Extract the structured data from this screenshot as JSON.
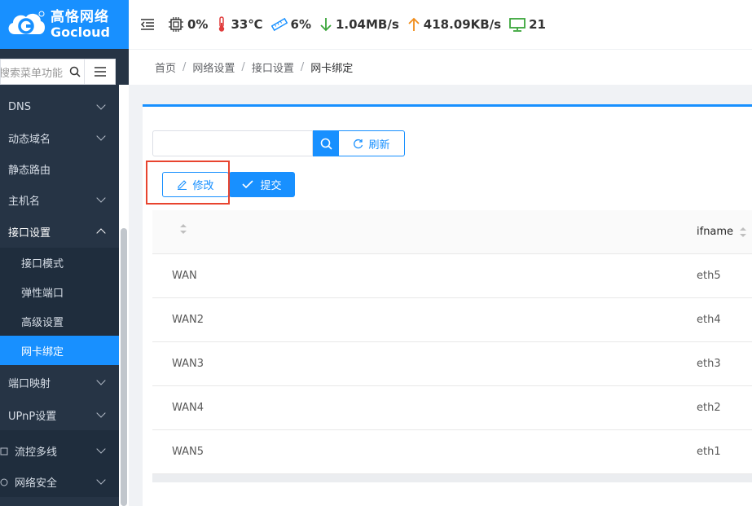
{
  "brand": {
    "name_cn": "高恪网络",
    "name_en": "Gocloud"
  },
  "header": {
    "cpu": "0%",
    "temperature": "33℃",
    "memory": "6%",
    "download": "1.04MB/s",
    "upload": "418.09KB/s",
    "devices": "21"
  },
  "sidebar": {
    "search_placeholder": "搜索菜单功能",
    "items": [
      {
        "label": "DNS",
        "expand": true
      },
      {
        "label": "动态域名",
        "expand": true
      },
      {
        "label": "静态路由",
        "expand": false
      },
      {
        "label": "主机名",
        "expand": true
      },
      {
        "label": "接口设置",
        "expand": true,
        "open": true,
        "children": [
          "接口模式",
          "弹性端口",
          "高级设置",
          "网卡绑定"
        ],
        "active_child": "网卡绑定"
      },
      {
        "label": "端口映射",
        "expand": true
      },
      {
        "label": "UPnP设置",
        "expand": true
      },
      {
        "label": "流控多线",
        "expand": true
      },
      {
        "label": "网络安全",
        "expand": true
      }
    ]
  },
  "breadcrumb": [
    "首页",
    "网络设置",
    "接口设置",
    "网卡绑定"
  ],
  "toolbar": {
    "search_value": "",
    "refresh_label": "刷新"
  },
  "actions": {
    "edit_label": "修改",
    "submit_label": "提交"
  },
  "table": {
    "columns": [
      "",
      "ifname"
    ],
    "rows": [
      [
        "WAN",
        "eth5"
      ],
      [
        "WAN2",
        "eth4"
      ],
      [
        "WAN3",
        "eth3"
      ],
      [
        "WAN4",
        "eth2"
      ],
      [
        "WAN5",
        "eth1"
      ]
    ]
  },
  "colors": {
    "primary": "#1890ff",
    "sidebar_bg": "#263445",
    "highlight": "#e8442f"
  }
}
